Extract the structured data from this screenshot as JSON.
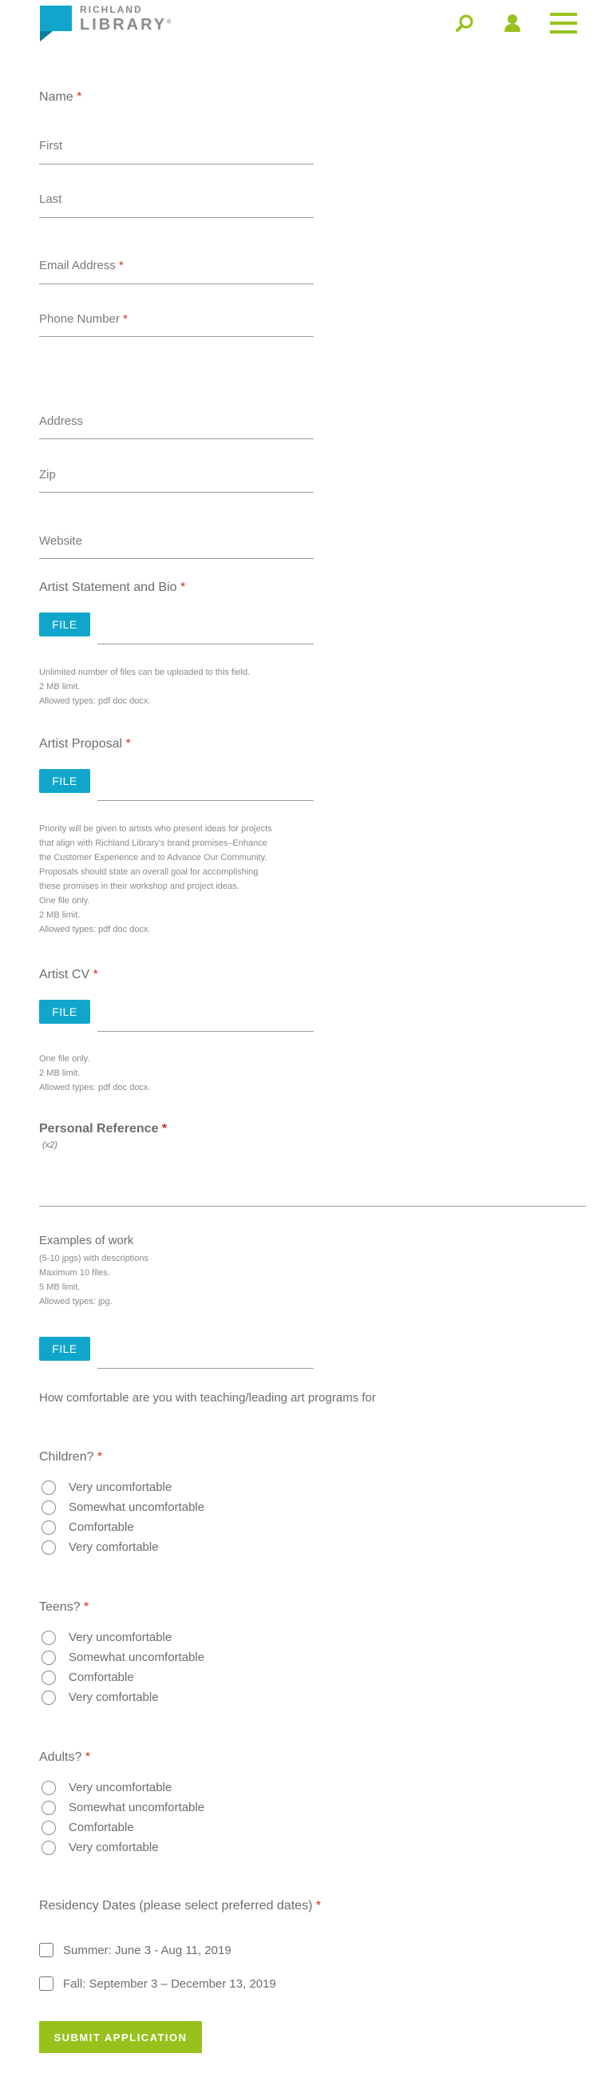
{
  "header": {
    "logo_line1": "RICHLAND",
    "logo_line2": "LIBRARY",
    "logo_reg": "®",
    "icons": [
      "search-icon",
      "user-icon",
      "menu-icon"
    ],
    "accent_color": "#97c21e",
    "logo_color": "#10a6cc"
  },
  "form": {
    "required_mark": "*",
    "name": {
      "label": "Name",
      "first": "First",
      "last": "Last"
    },
    "email": {
      "label": "Email Address"
    },
    "phone": {
      "label": "Phone Number"
    },
    "address": {
      "label": "Address"
    },
    "zip": {
      "label": "Zip"
    },
    "website": {
      "label": "Website"
    },
    "file_button": "FILE",
    "bio": {
      "label": "Artist Statement and Bio",
      "help": [
        "Unlimited number of files can be uploaded to this field.",
        "2 MB limit.",
        "Allowed types: pdf doc docx."
      ]
    },
    "proposal": {
      "label": "Artist Proposal",
      "help": [
        "Priority will be given to artists who present ideas for projects",
        "that align with Richland Library's brand promises–Enhance",
        "the Customer Experience and to Advance Our Community.",
        "Proposals should state an overall goal for accomplishing",
        "these promises in their workshop and project ideas.",
        "One file only.",
        "2 MB limit.",
        "Allowed types: pdf doc docx."
      ]
    },
    "cv": {
      "label": "Artist CV",
      "help": [
        "One file only.",
        "2 MB limit.",
        "Allowed types: pdf doc docx."
      ]
    },
    "reference": {
      "label": "Personal Reference",
      "note": "(x2)"
    },
    "examples": {
      "label": "Examples of work",
      "help": [
        "(5-10 jpgs) with descriptions",
        "Maximum 10 files.",
        "5 MB limit.",
        "Allowed types: jpg."
      ]
    },
    "comfort_intro": "How comfortable are you with teaching/leading art programs for",
    "comfort_options": [
      "Very uncomfortable",
      "Somewhat uncomfortable",
      "Comfortable",
      "Very comfortable"
    ],
    "children": {
      "label": "Children?"
    },
    "teens": {
      "label": "Teens?"
    },
    "adults": {
      "label": "Adults?"
    },
    "residency": {
      "label": "Residency Dates (please select preferred dates)",
      "options": [
        "Summer: June 3 - Aug 11, 2019",
        "Fall: September 3 – December 13, 2019"
      ]
    },
    "submit_label": "SUBMIT APPLICATION"
  }
}
